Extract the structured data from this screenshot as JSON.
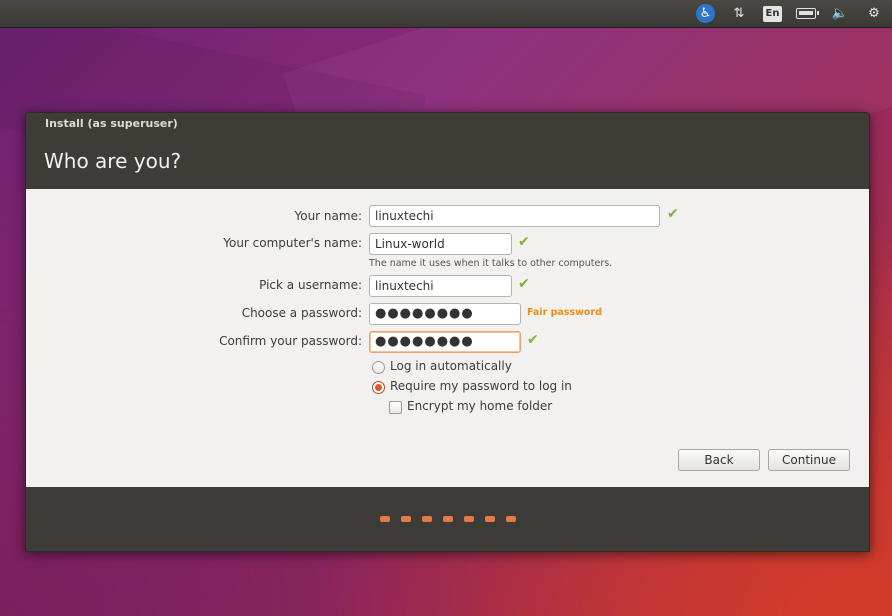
{
  "top_panel": {
    "accessibility_icon": "accessibility-icon",
    "network_icon": "network-arrows-icon",
    "keyboard_layout": "En",
    "battery_icon": "battery-icon",
    "volume_icon": "volume-icon",
    "settings_icon": "gear-icon",
    "network_glyph": "⇅",
    "volume_glyph": "🔈",
    "gear_glyph": "⚙",
    "a11y_glyph": "♿"
  },
  "window": {
    "title": "Install (as superuser)",
    "page_title": "Who are you?"
  },
  "form": {
    "name_label": "Your name:",
    "name_value": "linuxtechi",
    "computer_label": "Your computer's name:",
    "computer_value": "Linux-world",
    "computer_hint": "The name it uses when it talks to other computers.",
    "username_label": "Pick a username:",
    "username_value": "linuxtechi",
    "password_label": "Choose a password:",
    "password_value": "●●●●●●●●",
    "password_strength": "Fair password",
    "confirm_label": "Confirm your password:",
    "confirm_value": "●●●●●●●●",
    "check_glyph": "✔",
    "options": {
      "auto_login": "Log in automatically",
      "auto_login_selected": false,
      "require_password": "Require my password to log in",
      "require_password_selected": true,
      "encrypt_home": "Encrypt my home folder",
      "encrypt_home_checked": false
    }
  },
  "buttons": {
    "back": "Back",
    "continue": "Continue"
  },
  "progress": {
    "steps_total": 7
  },
  "colors": {
    "accent": "#dd5a25",
    "valid_check": "#7fb22e",
    "strength_fair": "#ee8c1d",
    "header_bg": "#3f3c37"
  }
}
